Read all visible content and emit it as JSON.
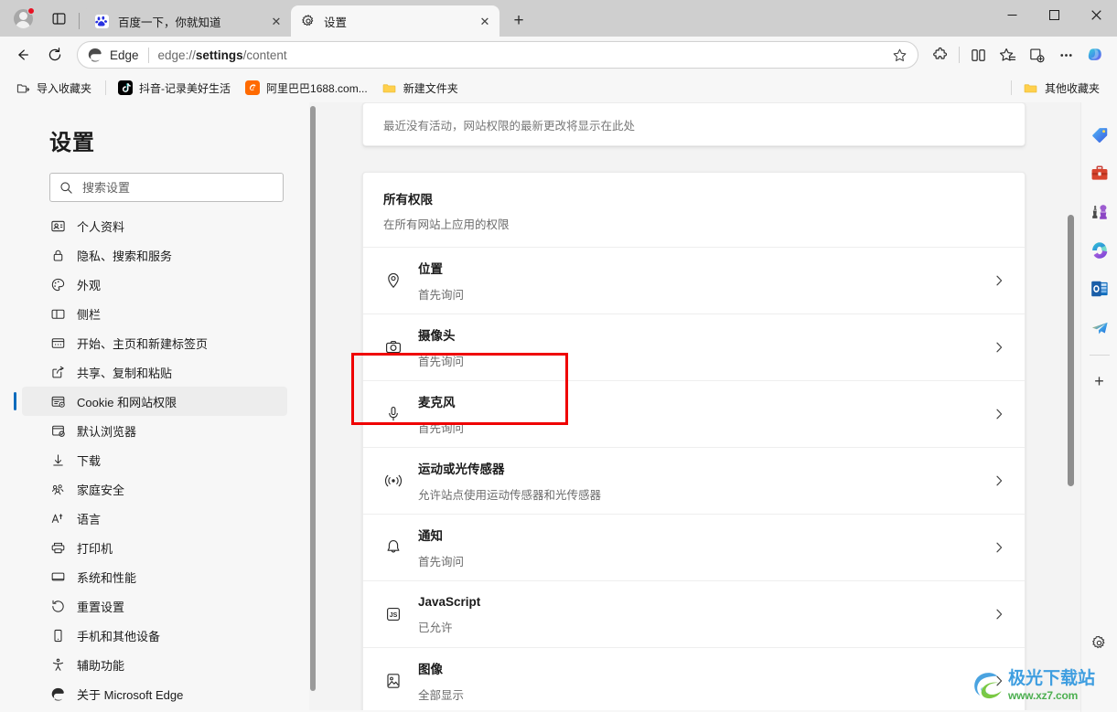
{
  "window": {
    "controls": {
      "minimize": "—",
      "maximize": "☐",
      "close": "✕"
    }
  },
  "tabs": [
    {
      "title": "百度一下，你就知道",
      "icon": "baidu-favicon",
      "active": false,
      "close_label": "✕"
    },
    {
      "title": "设置",
      "icon": "gear-favicon",
      "active": true,
      "close_label": "✕"
    }
  ],
  "tabstrip": {
    "new_tab_label": "+",
    "profile_icon": "profile-avatar-icon",
    "tab_actions_icon": "tab-actions-icon"
  },
  "toolbar": {
    "back_icon": "back-arrow-icon",
    "refresh_icon": "refresh-icon",
    "brand_label": "Edge",
    "url_prefix": "edge://",
    "url_bold": "settings",
    "url_suffix": "/content",
    "favorite_icon": "star-outline-icon",
    "extensions_icon": "puzzle-icon",
    "split_screen_icon": "split-screen-icon",
    "favorites_icon": "favorites-star-icon",
    "collections_icon": "collections-icon",
    "more_icon": "more-ellipsis-icon",
    "copilot_icon": "copilot-icon"
  },
  "bookmarks": {
    "items": [
      {
        "label": "导入收藏夹",
        "icon": "import-favorites-icon"
      },
      {
        "label": "抖音-记录美好生活",
        "icon": "douyin-icon"
      },
      {
        "label": "阿里巴巴1688.com...",
        "icon": "alibaba-icon"
      },
      {
        "label": "新建文件夹",
        "icon": "folder-icon"
      }
    ],
    "other": {
      "label": "其他收藏夹",
      "icon": "folder-icon"
    }
  },
  "settings": {
    "title": "设置",
    "search": {
      "placeholder": "搜索设置",
      "value": "",
      "icon": "search-icon"
    },
    "nav_items": [
      {
        "label": "个人资料",
        "icon": "profile-card-icon",
        "selected": false
      },
      {
        "label": "隐私、搜索和服务",
        "icon": "lock-icon",
        "selected": false
      },
      {
        "label": "外观",
        "icon": "palette-icon",
        "selected": false
      },
      {
        "label": "侧栏",
        "icon": "sidebar-icon",
        "selected": false
      },
      {
        "label": "开始、主页和新建标签页",
        "icon": "home-page-icon",
        "selected": false
      },
      {
        "label": "共享、复制和粘贴",
        "icon": "share-icon",
        "selected": false
      },
      {
        "label": "Cookie 和网站权限",
        "icon": "cookie-permissions-icon",
        "selected": true
      },
      {
        "label": "默认浏览器",
        "icon": "default-browser-icon",
        "selected": false
      },
      {
        "label": "下载",
        "icon": "download-icon",
        "selected": false
      },
      {
        "label": "家庭安全",
        "icon": "family-safety-icon",
        "selected": false
      },
      {
        "label": "语言",
        "icon": "language-icon",
        "selected": false
      },
      {
        "label": "打印机",
        "icon": "printer-icon",
        "selected": false
      },
      {
        "label": "系统和性能",
        "icon": "system-icon",
        "selected": false
      },
      {
        "label": "重置设置",
        "icon": "reset-icon",
        "selected": false
      },
      {
        "label": "手机和其他设备",
        "icon": "phone-icon",
        "selected": false
      },
      {
        "label": "辅助功能",
        "icon": "accessibility-icon",
        "selected": false
      },
      {
        "label": "关于 Microsoft Edge",
        "icon": "edge-logo-icon",
        "selected": false
      }
    ]
  },
  "main": {
    "recent_activity_text": "最近没有活动，网站权限的最新更改将显示在此处",
    "all_permissions": {
      "heading": "所有权限",
      "description": "在所有网站上应用的权限"
    },
    "permissions": [
      {
        "title": "位置",
        "status": "首先询问",
        "icon": "location-pin-icon"
      },
      {
        "title": "摄像头",
        "status": "首先询问",
        "icon": "camera-icon"
      },
      {
        "title": "麦克风",
        "status": "首先询问",
        "icon": "microphone-icon"
      },
      {
        "title": "运动或光传感器",
        "status": "允许站点使用运动传感器和光传感器",
        "icon": "motion-sensor-icon"
      },
      {
        "title": "通知",
        "status": "首先询问",
        "icon": "bell-icon"
      },
      {
        "title": "JavaScript",
        "status": "已允许",
        "icon": "javascript-icon"
      },
      {
        "title": "图像",
        "status": "全部显示",
        "icon": "image-icon"
      }
    ],
    "chevron": "›"
  },
  "right_sidebar": {
    "icons": [
      "shopping-tag-icon",
      "tools-briefcase-icon",
      "games-icon",
      "microsoft-365-icon",
      "outlook-icon",
      "send-plane-icon"
    ],
    "add_label": "+",
    "settings_icon": "sidebar-settings-icon"
  },
  "watermark": {
    "title": "极光下载站",
    "url": "www.xz7.com"
  },
  "colors": {
    "accent": "#0f6cbd",
    "annotation": "#ef0000",
    "titlebar": "#cfcfcf",
    "toolbar": "#f7f7f7",
    "page_bg": "#f3f3f3"
  }
}
